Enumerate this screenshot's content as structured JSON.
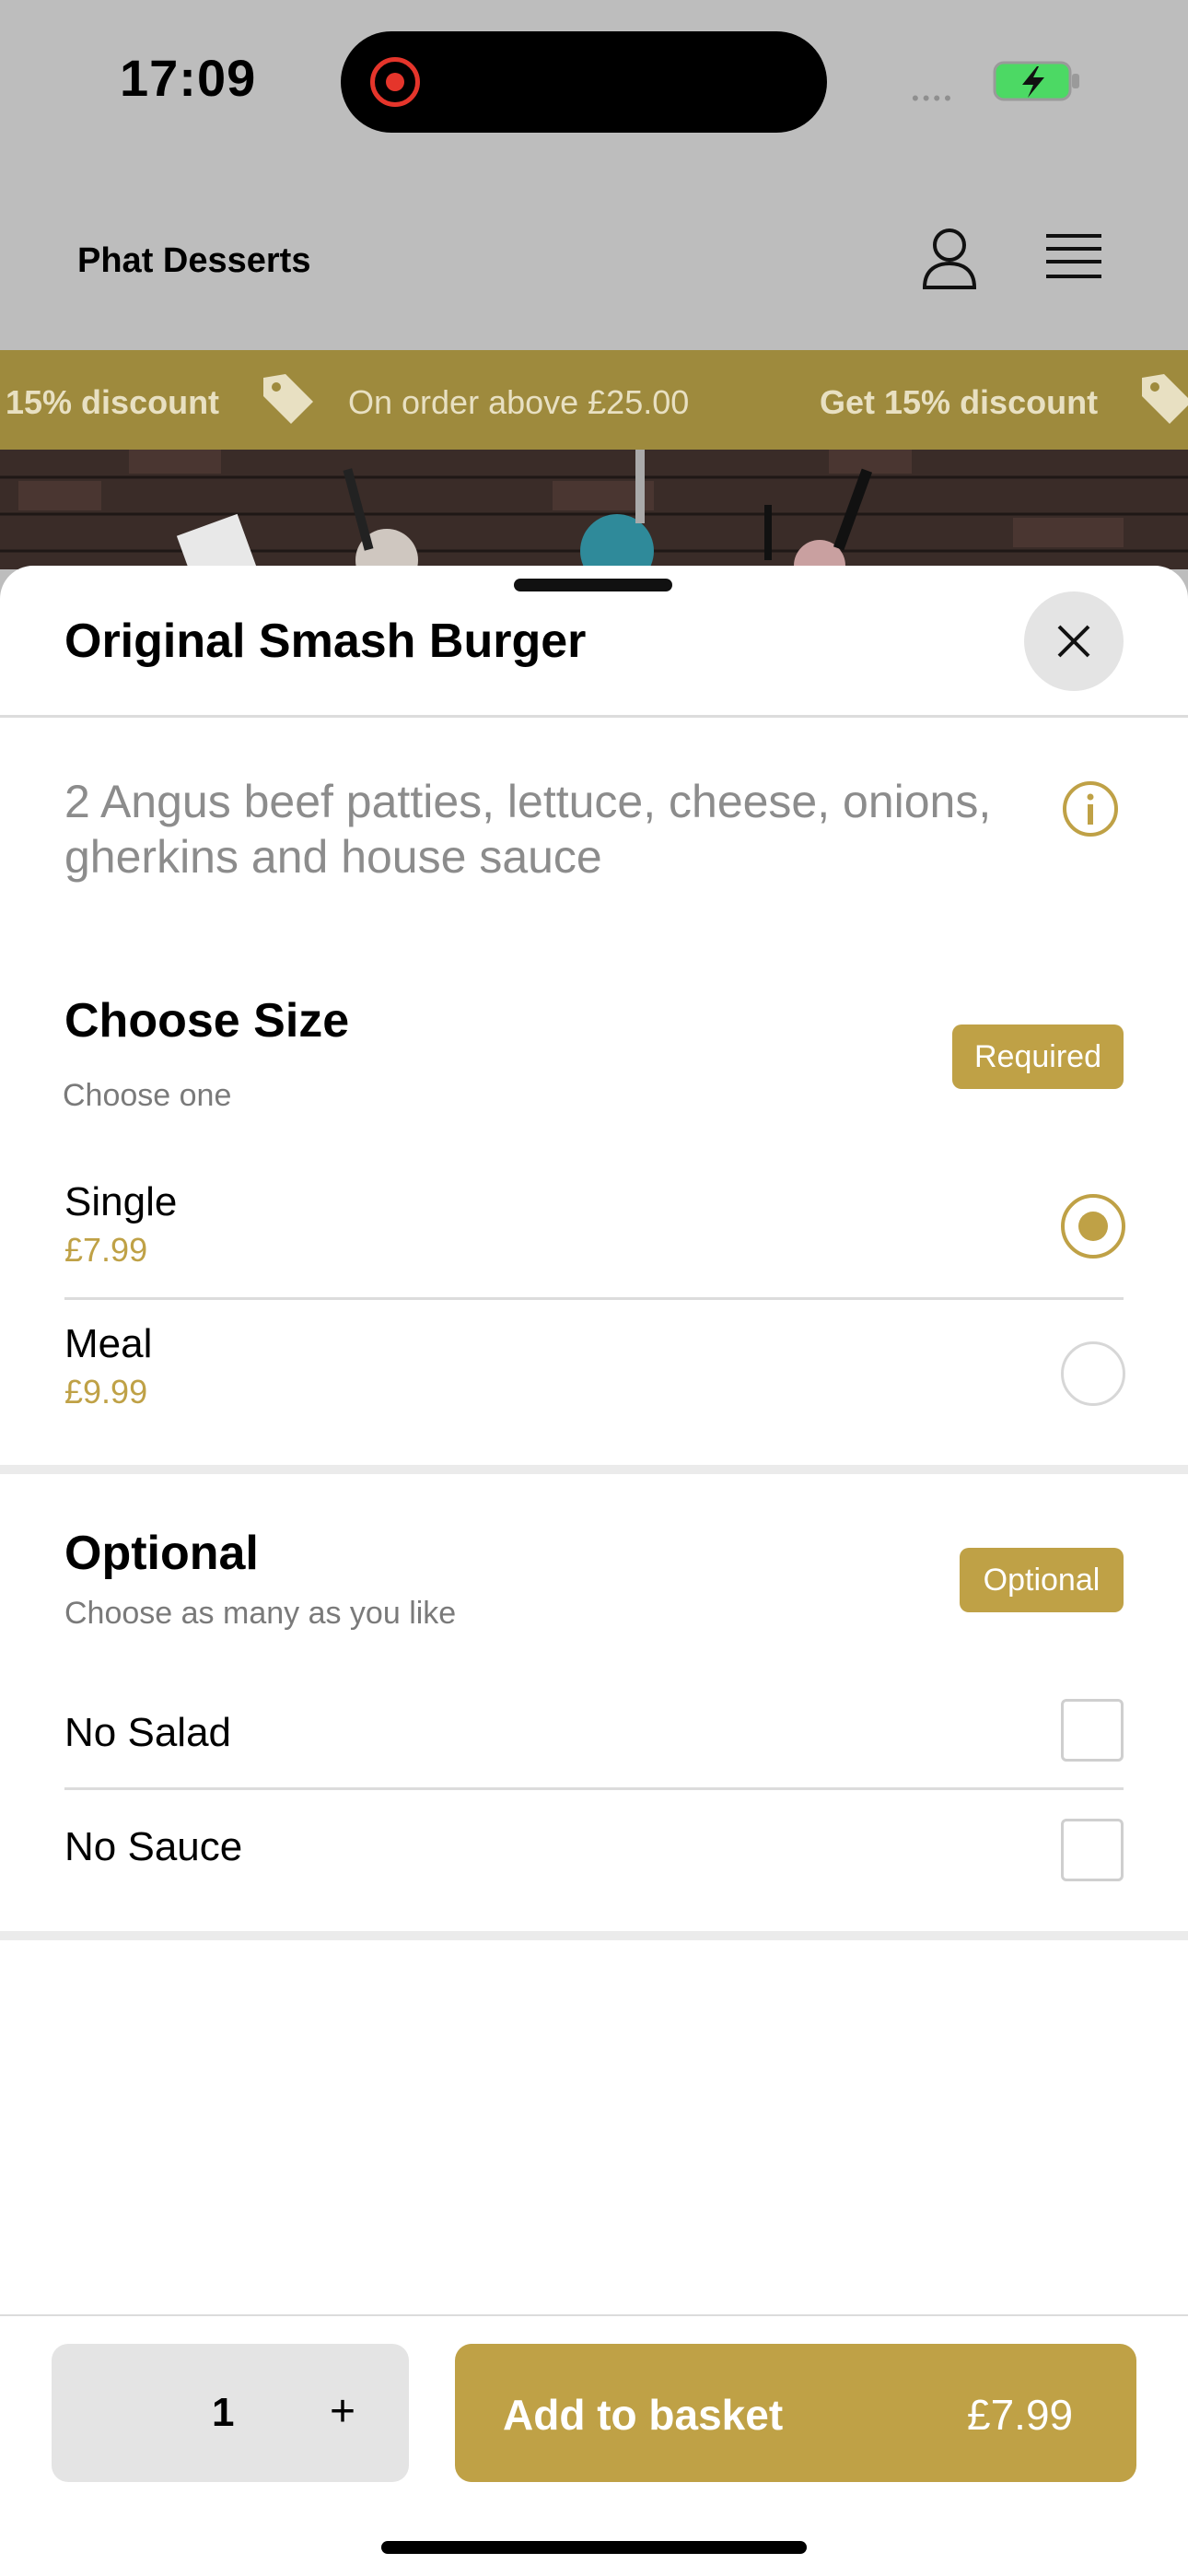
{
  "status_bar": {
    "time": "17:09",
    "signal": "••••"
  },
  "header": {
    "brand": "Phat Desserts"
  },
  "banner": {
    "items": [
      "15% discount",
      "On order above £25.00",
      "Get 15% discount"
    ]
  },
  "sheet": {
    "title": "Original Smash Burger",
    "description": "2 Angus beef patties, lettuce, cheese, onions, gherkins and house sauce",
    "size_section": {
      "title": "Choose Size",
      "subtitle": "Choose one",
      "badge": "Required",
      "options": [
        {
          "label": "Single",
          "price": "£7.99",
          "selected": true
        },
        {
          "label": "Meal",
          "price": "£9.99",
          "selected": false
        }
      ]
    },
    "optional_section": {
      "title": "Optional",
      "subtitle": "Choose as many as you like",
      "badge": "Optional",
      "options": [
        {
          "label": "No Salad",
          "checked": false
        },
        {
          "label": "No Sauce",
          "checked": false
        }
      ]
    }
  },
  "footer": {
    "quantity": "1",
    "plus": "+",
    "add_label": "Add to basket",
    "add_price": "£7.99"
  },
  "colors": {
    "accent": "#bfa146",
    "banner": "#9e8a3d"
  }
}
